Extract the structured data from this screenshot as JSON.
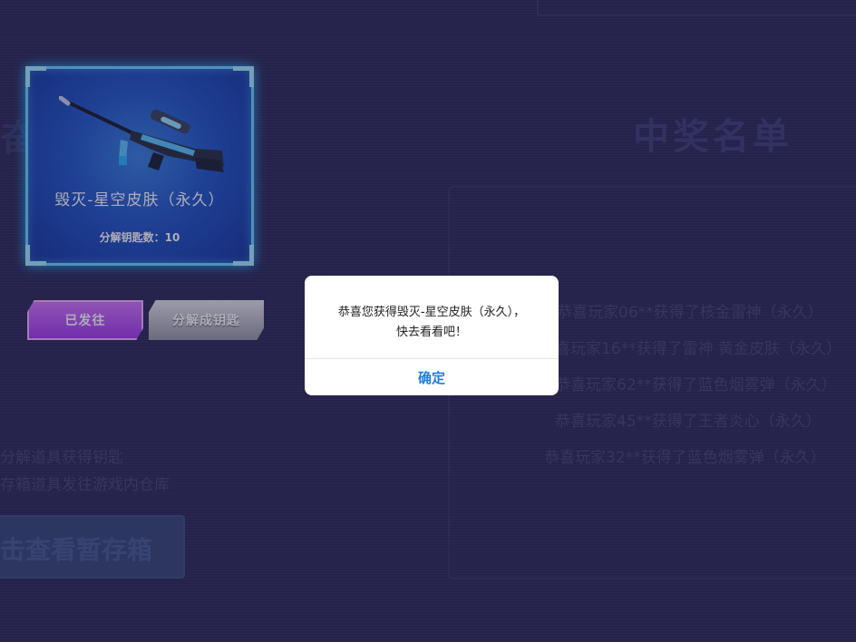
{
  "background": {
    "left_title_fragment": "奋",
    "right_title": "中奖名单",
    "winners": [
      "恭喜玩家06**获得了核金雷神（永久）",
      "喜玩家16**获得了雷神 黄金皮肤（永久）",
      "恭喜玩家62**获得了蓝色烟雾弹（永久）",
      "恭喜玩家45**获得了王者炎心（永久）",
      "恭喜玩家32**获得了蓝色烟雾弹（永久）"
    ],
    "rules": [
      "分解道具获得钥匙",
      "存箱道具发往游戏内仓库"
    ],
    "view_storage_button": "击查看暂存箱"
  },
  "prize": {
    "item_name": "毁灭-星空皮肤（永久）",
    "key_count_text": "分解钥匙数：10",
    "image_icon": "sniper-rifle-icon"
  },
  "actions": {
    "sent_label": "已发往",
    "decompose_label": "分解成钥匙"
  },
  "modal": {
    "message_line1": "恭喜您获得毁灭-星空皮肤（永久），",
    "message_line2": "快去看看吧！",
    "ok_label": "确定"
  },
  "colors": {
    "page_bg": "#2e2c5a",
    "card_border": "#6fd6ff",
    "sent_button": "#b450f0",
    "ok_text": "#1e7fe0"
  }
}
